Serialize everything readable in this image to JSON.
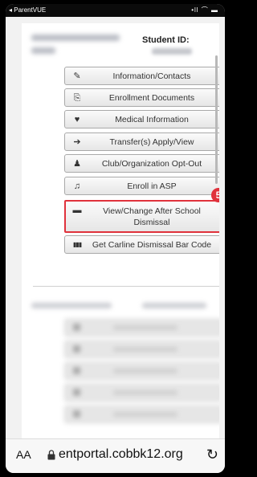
{
  "status_bar": {
    "app_back_label": "◂ ParentVUE",
    "signal": "•ll ⌒ ▬"
  },
  "header": {
    "student_id_label": "Student ID:"
  },
  "menu": [
    {
      "name": "information-contacts",
      "label": "Information/Contacts",
      "icon": "pencil-icon",
      "glyph": "✎"
    },
    {
      "name": "enrollment-documents",
      "label": "Enrollment Documents",
      "icon": "documents-icon",
      "glyph": "⎘"
    },
    {
      "name": "medical-information",
      "label": "Medical Information",
      "icon": "heartbeat-icon",
      "glyph": "♥"
    },
    {
      "name": "transfers-apply-view",
      "label": "Transfer(s) Apply/View",
      "icon": "arrow-icon",
      "glyph": "➔"
    },
    {
      "name": "club-organization-opt-out",
      "label": "Club/Organization Opt-Out",
      "icon": "person-icon",
      "glyph": "♟"
    },
    {
      "name": "enroll-in-asp",
      "label": "Enroll in ASP",
      "icon": "bell-icon",
      "glyph": "♫"
    },
    {
      "name": "view-change-after-school-dismissal",
      "label": "View/Change After School Dismissal",
      "icon": "bus-icon",
      "glyph": "▬"
    },
    {
      "name": "get-carline-dismissal-bar-code",
      "label": "Get Carline Dismissal Bar Code",
      "icon": "barcode-icon",
      "glyph": "▮▮▮"
    }
  ],
  "annotation": {
    "step_number": "5",
    "highlight_color": "#e0323c"
  },
  "url_bar": {
    "text_size_label": "AA",
    "url": "entportal.cobbk12.org",
    "reload_glyph": "↻"
  }
}
